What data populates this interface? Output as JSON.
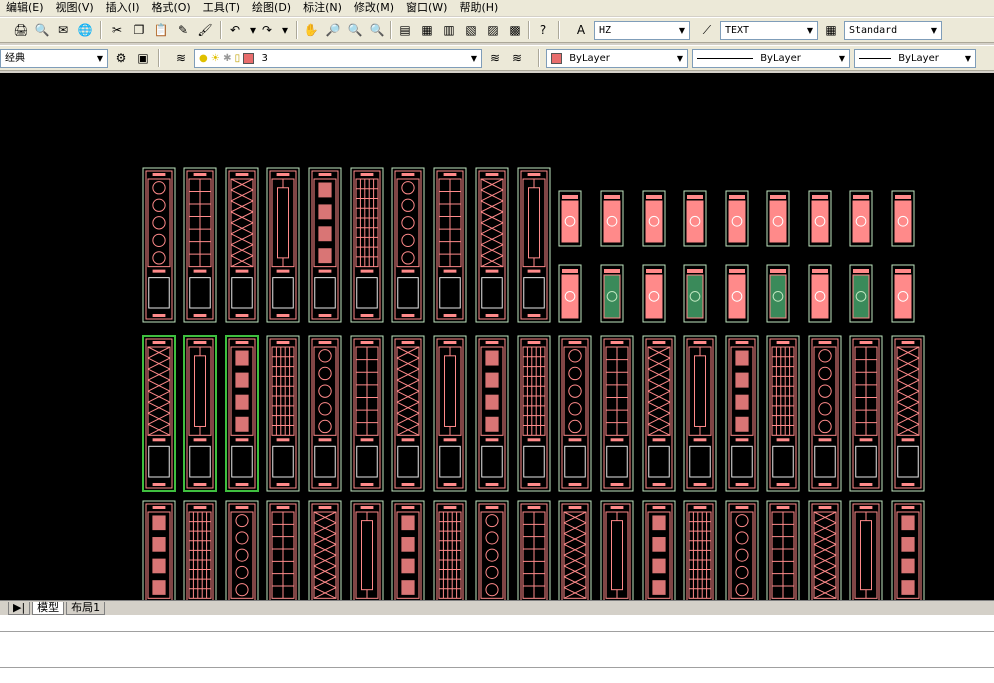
{
  "menu": {
    "items": [
      "编辑(E)",
      "视图(V)",
      "插入(I)",
      "格式(O)",
      "工具(T)",
      "绘图(D)",
      "标注(N)",
      "修改(M)",
      "窗口(W)",
      "帮助(H)"
    ]
  },
  "toolbar1": {
    "text_style": "HZ",
    "dim_style": "TEXT",
    "table_style": "Standard"
  },
  "toolbar2": {
    "workspace": "经典",
    "layer": "3",
    "color": "ByLayer",
    "linetype": "ByLayer",
    "lineweight": "ByLayer",
    "color_swatch": "#e86d6d"
  },
  "tabs": {
    "nav": "▶|",
    "model": "模型",
    "layout1": "布局1"
  },
  "drawing": {
    "colors": {
      "background": "#000000",
      "pink": "#ff8a8a",
      "pale_green": "#bfe6bf",
      "green": "#3fbf3f",
      "white": "#e8e8e8"
    }
  }
}
